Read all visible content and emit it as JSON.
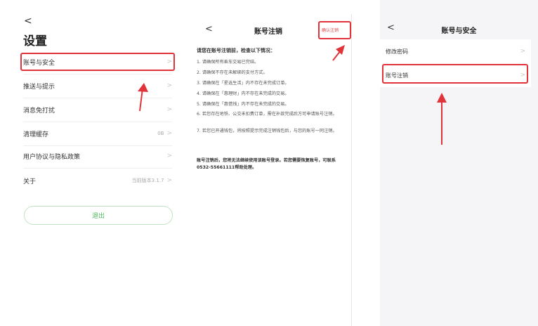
{
  "settings": {
    "back": "<",
    "title": "设置",
    "items": [
      {
        "label": "账号与安全",
        "value": ""
      },
      {
        "label": "推送与提示",
        "value": ""
      },
      {
        "label": "消息免打扰",
        "value": ""
      },
      {
        "label": "清理缓存",
        "value": "0B"
      },
      {
        "label": "用户协议与隐私政策",
        "value": ""
      },
      {
        "label": "关于",
        "value": "当前版本3.1.7"
      }
    ],
    "logout": "退出"
  },
  "cancel": {
    "back": "<",
    "title": "账号注销",
    "confirm": "确认注销",
    "heading": "请您在账号注销前，检查以下情况：",
    "items": [
      "1. 请确保所有乘车交易已完结。",
      "2. 请确保不存在未解绑的支付方式。",
      "3. 请确保在「星选生活」内不存在未完成订单。",
      "4. 请确保在「惠理财」内不存在未完成的交易。",
      "5. 请确保在「惠借钱」内不存在未完成的交易。",
      "6. 若您存在地铁、公交未扣费订单，需在补款完成后方可申请账号注销。",
      "7. 若您已开通钱包，将按照提示完成注销钱包后，与您的账号一同注销。"
    ],
    "note": "账号注销后，您将无法继续使用该账号登录。若您需要恢复账号，可联系0532-55661111帮助处理。"
  },
  "security": {
    "back": "<",
    "title": "账号与安全",
    "items": [
      {
        "label": "修改密码"
      },
      {
        "label": "账号注销"
      }
    ]
  },
  "colors": {
    "annotation_red": "#e0333a",
    "logout_green": "#4bb55a",
    "confirm_red": "#e0454c"
  }
}
